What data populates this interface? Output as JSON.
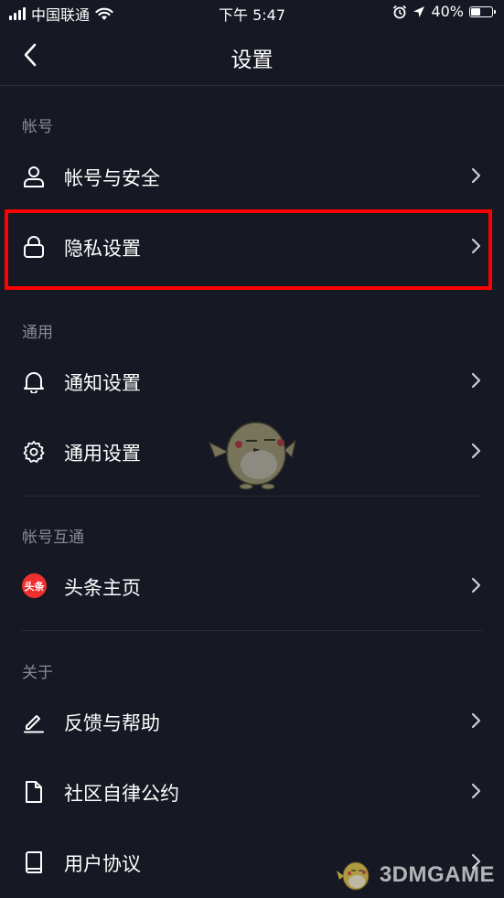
{
  "status_bar": {
    "carrier": "中国联通",
    "time": "下午 5:47",
    "battery_text": "40%",
    "battery_level": 0.4
  },
  "nav": {
    "title": "设置"
  },
  "sections": [
    {
      "header": "帐号",
      "items": [
        {
          "label": "帐号与安全",
          "icon": "user-icon"
        },
        {
          "label": "隐私设置",
          "icon": "lock-icon",
          "highlighted": true
        }
      ]
    },
    {
      "header": "通用",
      "items": [
        {
          "label": "通知设置",
          "icon": "bell-icon"
        },
        {
          "label": "通用设置",
          "icon": "gear-icon"
        }
      ]
    },
    {
      "header": "帐号互通",
      "items": [
        {
          "label": "头条主页",
          "icon": "toutiao-icon",
          "badge_text": "头条"
        }
      ]
    },
    {
      "header": "关于",
      "items": [
        {
          "label": "反馈与帮助",
          "icon": "pen-icon"
        },
        {
          "label": "社区自律公约",
          "icon": "document-icon"
        },
        {
          "label": "用户协议",
          "icon": "book-icon"
        }
      ]
    }
  ],
  "watermark": {
    "text": "3DMGAME"
  },
  "colors": {
    "background": "#161823",
    "highlight": "#ff0000",
    "section_header": "#8a8b91",
    "toutiao_red": "#ee2f2f"
  }
}
